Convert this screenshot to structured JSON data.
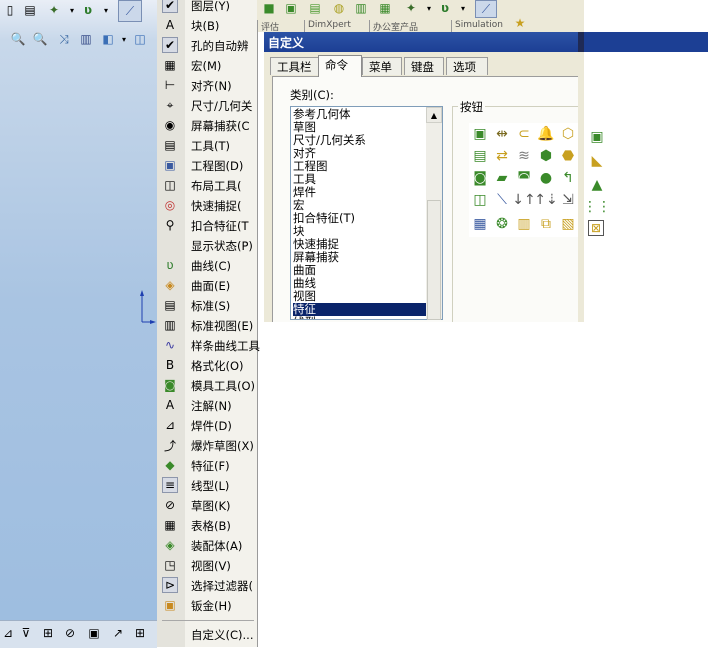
{
  "menu": {
    "items": [
      {
        "label": "图层(Y)",
        "icon": "layer-icon",
        "checked": true
      },
      {
        "label": "块(B)",
        "icon": "block-icon",
        "checked": false
      },
      {
        "label": "孔的自动辨",
        "icon": "check-icon",
        "checked": true
      },
      {
        "label": "宏(M)",
        "icon": "macro-icon",
        "checked": false
      },
      {
        "label": "对齐(N)",
        "icon": "align-icon",
        "checked": false
      },
      {
        "label": "尺寸/几何关",
        "icon": "dimension-icon",
        "checked": false
      },
      {
        "label": "屏幕捕获(C",
        "icon": "screen-capture-icon",
        "checked": false
      },
      {
        "label": "工具(T)",
        "icon": "tools-icon",
        "checked": false
      },
      {
        "label": "工程图(D)",
        "icon": "drawing-icon",
        "checked": false
      },
      {
        "label": "布局工具(",
        "icon": "layout-tools-icon",
        "checked": false
      },
      {
        "label": "快速捕捉(",
        "icon": "quick-snap-icon",
        "checked": false
      },
      {
        "label": "扣合特征(T",
        "icon": "fastening-feature-icon",
        "checked": false
      },
      {
        "label": "显示状态(P)",
        "icon": "",
        "checked": false
      },
      {
        "label": "曲线(C)",
        "icon": "curve-icon",
        "checked": false
      },
      {
        "label": "曲面(E)",
        "icon": "surface-icon",
        "checked": false
      },
      {
        "label": "标准(S)",
        "icon": "standard-icon",
        "checked": false
      },
      {
        "label": "标准视图(E)",
        "icon": "standard-view-icon",
        "checked": false
      },
      {
        "label": "样条曲线工具",
        "icon": "spline-tools-icon",
        "checked": false
      },
      {
        "label": "格式化(O)",
        "icon": "format-icon",
        "checked": false
      },
      {
        "label": "模具工具(O)",
        "icon": "mold-tools-icon",
        "checked": false
      },
      {
        "label": "注解(N)",
        "icon": "annotation-icon",
        "checked": false
      },
      {
        "label": "焊件(D)",
        "icon": "weldment-icon",
        "checked": false
      },
      {
        "label": "爆炸草图(X)",
        "icon": "explode-sketch-icon",
        "checked": false
      },
      {
        "label": "特征(F)",
        "icon": "features-icon",
        "checked": false
      },
      {
        "label": "线型(L)",
        "icon": "line-format-icon",
        "checked": true
      },
      {
        "label": "草图(K)",
        "icon": "sketch-icon",
        "checked": false
      },
      {
        "label": "表格(B)",
        "icon": "table-icon",
        "checked": false
      },
      {
        "label": "装配体(A)",
        "icon": "assembly-icon",
        "checked": false
      },
      {
        "label": "视图(V)",
        "icon": "view-icon",
        "checked": false
      },
      {
        "label": "选择过滤器(",
        "icon": "selection-filter-icon",
        "checked": true
      },
      {
        "label": "钣金(H)",
        "icon": "sheet-metal-icon",
        "checked": false
      }
    ],
    "customize_label": "自定义(C)..."
  },
  "background_tabs": [
    "评估",
    "DimXpert",
    "办公室产品",
    "Simulation"
  ],
  "dialog": {
    "title": "自定义",
    "tabs": [
      "工具栏",
      "命令",
      "菜单",
      "键盘",
      "选项"
    ],
    "active_tab": 1,
    "category_label": "类别(C):",
    "categories": [
      "参考几何体",
      "草图",
      "尺寸/几何关系",
      "对齐",
      "工程图",
      "工具",
      "焊件",
      "宏",
      "扣合特征(T)",
      "块",
      "快速捕捉",
      "屏幕捕获",
      "曲面",
      "曲线",
      "视图",
      "特征",
      "线型"
    ],
    "selected_category": "特征",
    "buttons_group_label": "按钮"
  },
  "colors": {
    "title_bar": "#1c3f94",
    "selection": "#0a246a",
    "viewport": "#a9c4e2"
  }
}
